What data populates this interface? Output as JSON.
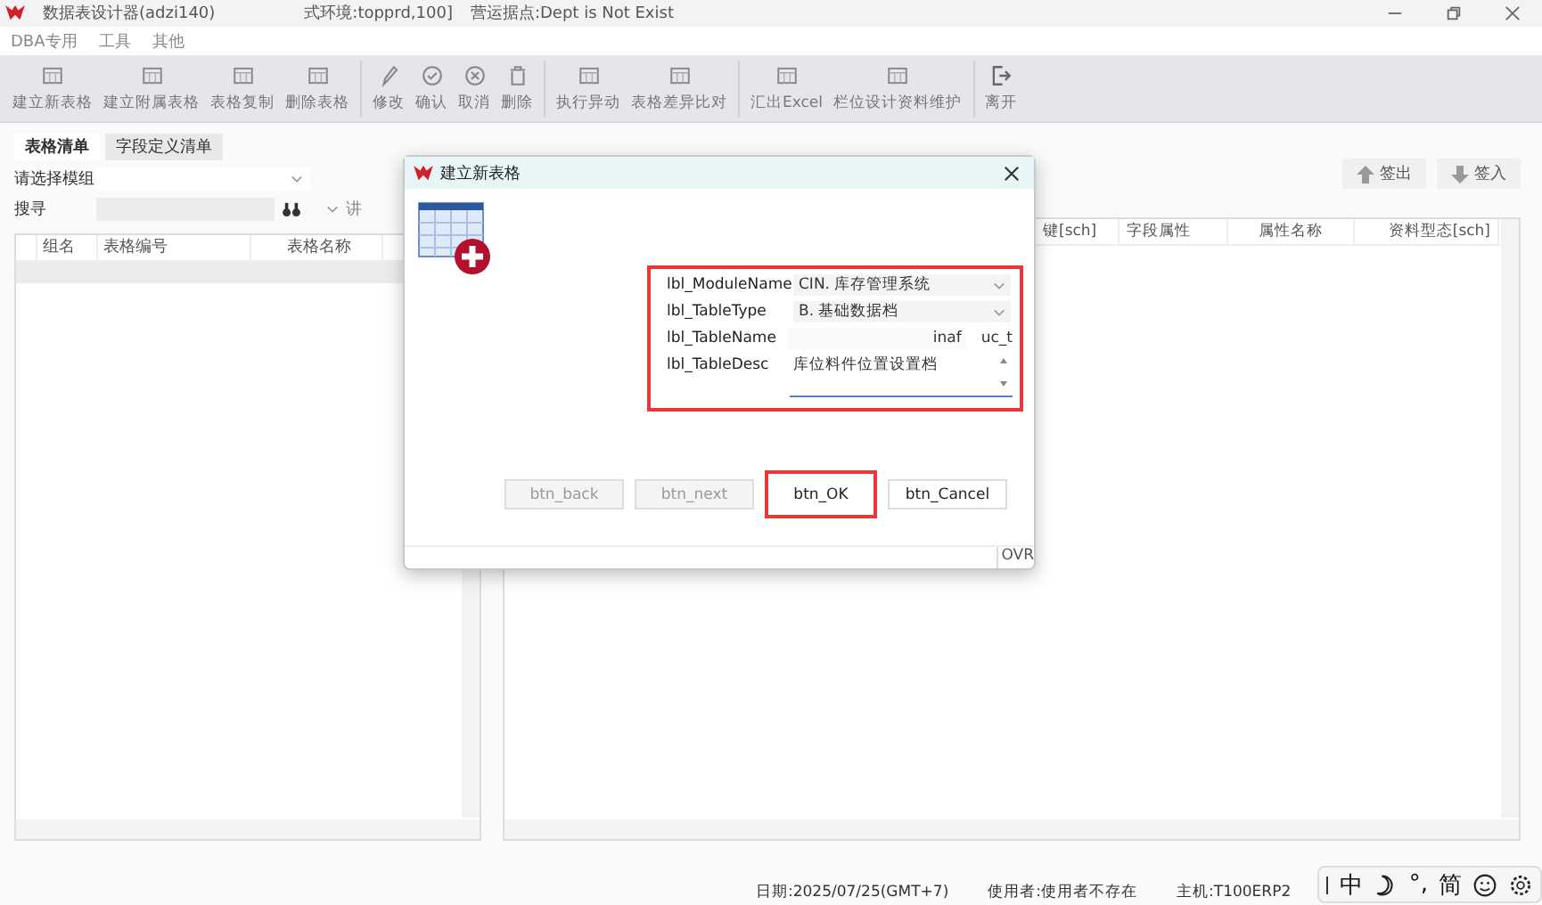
{
  "window": {
    "title": "数据表设计器(adzi140)",
    "environment": "式环境:topprd,100]",
    "site": "营运据点:Dept is Not Exist"
  },
  "menu": [
    "DBA专用",
    "工具",
    "其他"
  ],
  "toolbar": [
    "建立新表格",
    "建立附属表格",
    "表格复制",
    "删除表格",
    "修改",
    "确认",
    "取消",
    "删除",
    "执行异动",
    "表格差异比对",
    "汇出Excel",
    "栏位设计资料维护",
    "离开"
  ],
  "left_panel": {
    "tabs": [
      {
        "label": "表格清单",
        "selected": true
      },
      {
        "label": "字段定义清单",
        "selected": false
      }
    ],
    "module_label": "请选择模组",
    "search_label": "搜寻",
    "extra_dropdown": "讲",
    "columns": [
      "组名",
      "表格编号",
      "表格名称"
    ]
  },
  "right_panel": {
    "buttons": [
      "签出",
      "签入"
    ],
    "columns": [
      "键[sch]",
      "字段属性",
      "属性名称",
      "资料型态[sch]"
    ]
  },
  "dialog": {
    "title": "建立新表格",
    "fields": [
      {
        "label": "lbl_ModuleName",
        "kind": "dropdown",
        "value": "CIN. 库存管理系统"
      },
      {
        "label": "lbl_TableType",
        "kind": "dropdown",
        "value": "B. 基础数据档"
      },
      {
        "label": "lbl_TableName",
        "kind": "text",
        "value": "inaf",
        "suffix": "uc_t"
      },
      {
        "label": "lbl_TableDesc",
        "kind": "memo",
        "value": "库位料件位置设置档"
      }
    ],
    "buttons": [
      {
        "label": "btn_back",
        "disabled": true,
        "highlighted": false
      },
      {
        "label": "btn_next",
        "disabled": true,
        "highlighted": false
      },
      {
        "label": "btn_OK",
        "disabled": false,
        "highlighted": true
      },
      {
        "label": "btn_Cancel",
        "disabled": false,
        "highlighted": false
      }
    ],
    "status": "OVR"
  },
  "status_bar": [
    "日期:2025/07/25(GMT+7)",
    "使用者:使用者不存在",
    "主机:T100ERP2"
  ],
  "ime_bar": [
    "中",
    "°,",
    "简"
  ]
}
